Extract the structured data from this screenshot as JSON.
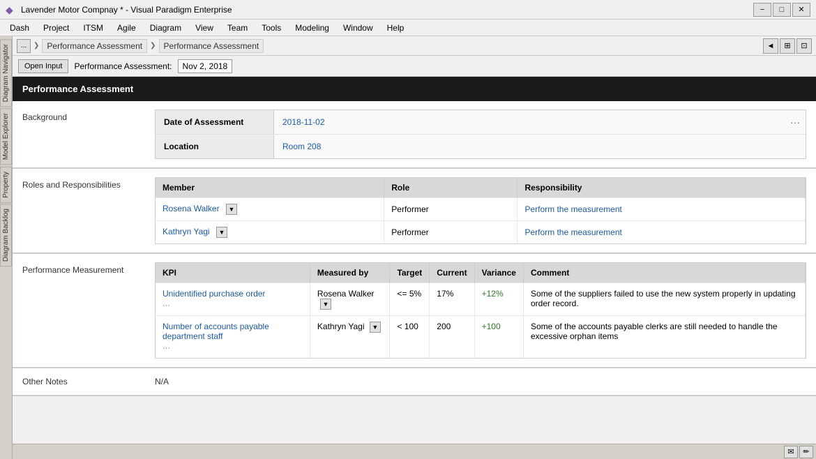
{
  "titleBar": {
    "icon": "◆",
    "title": "Lavender Motor Compnay * - Visual Paradigm Enterprise",
    "minimize": "−",
    "maximize": "□",
    "close": "✕"
  },
  "menuBar": {
    "items": [
      "Dash",
      "Project",
      "ITSM",
      "Agile",
      "Diagram",
      "View",
      "Team",
      "Tools",
      "Modeling",
      "Window",
      "Help"
    ]
  },
  "breadcrumb": {
    "navBtn": "...",
    "items": [
      "Performance Assessment",
      "Performance Assessment"
    ],
    "rightControls": [
      "◄",
      "⊞",
      "⊡"
    ]
  },
  "toolbar": {
    "openInputLabel": "Open Input",
    "assessmentLabel": "Performance Assessment:",
    "assessmentDate": "Nov 2, 2018"
  },
  "document": {
    "title": "Performance Assessment",
    "background": {
      "sectionLabel": "Background",
      "fields": [
        {
          "label": "Date of Assessment",
          "value": "2018-11-02"
        },
        {
          "label": "Location",
          "value": "Room 208"
        }
      ]
    },
    "rolesSection": {
      "sectionLabel": "Roles and Responsibilities",
      "columns": [
        "Member",
        "Role",
        "Responsibility"
      ],
      "rows": [
        {
          "member": "Rosena Walker",
          "role": "Performer",
          "responsibility": "Perform the measurement"
        },
        {
          "member": "Kathryn Yagi",
          "role": "Performer",
          "responsibility": "Perform the measurement"
        }
      ]
    },
    "performanceSection": {
      "sectionLabel": "Performance Measurement",
      "columns": [
        "KPI",
        "Measured by",
        "Target",
        "Current",
        "Variance",
        "Comment"
      ],
      "rows": [
        {
          "kpi": "Unidentified purchase order",
          "measuredBy": "Rosena Walker",
          "target": "<= 5%",
          "current": "17%",
          "variance": "+12%",
          "comment": "Some of the suppliers failed to use the new system properly in updating order record."
        },
        {
          "kpi": "Number of accounts payable department staff",
          "measuredBy": "Kathryn Yagi",
          "target": "< 100",
          "current": "200",
          "variance": "+100",
          "comment": "Some of the accounts payable clerks are still needed to handle the excessive orphan items"
        }
      ]
    },
    "notesSection": {
      "sectionLabel": "Other Notes",
      "value": "N/A"
    }
  },
  "leftSidebar": {
    "tabs": [
      "Diagram Navigator",
      "Model Explorer",
      "Property",
      "Diagram Backlog"
    ]
  },
  "bottomBar": {
    "emailIcon": "✉",
    "editIcon": "✏"
  }
}
